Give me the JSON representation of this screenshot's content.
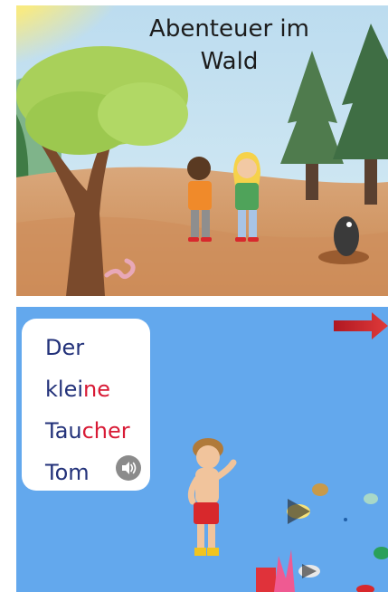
{
  "cover": {
    "title_line1": "Abenteuer im",
    "title_line2": "Wald"
  },
  "page2": {
    "words": [
      {
        "plain": "Der",
        "highlight": ""
      },
      {
        "plain": "klei",
        "highlight": "ne"
      },
      {
        "plain": "Tau",
        "highlight": "cher"
      },
      {
        "plain": "Tom",
        "highlight": ""
      }
    ],
    "speaker_icon": "speaker-icon",
    "next_icon": "arrow-right-icon"
  },
  "colors": {
    "word_text": "#23327a",
    "word_highlight": "#d81a35",
    "underwater_bg": "#6aaef0",
    "arrow": "#c9202a"
  }
}
